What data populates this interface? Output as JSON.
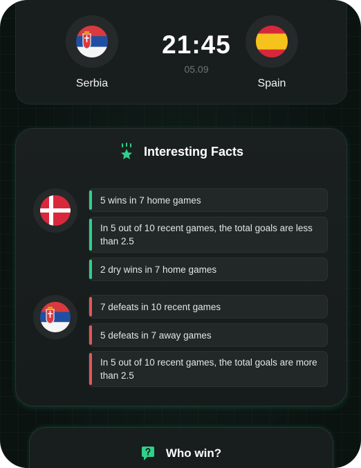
{
  "match": {
    "home_team": "Serbia",
    "away_team": "Spain",
    "time": "21:45",
    "date": "05.09"
  },
  "facts_section": {
    "title": "Interesting Facts",
    "home_facts": [
      "5 wins in 7 home games",
      "In 5 out of 10 recent games, the total goals are less than 2.5",
      "2 dry wins in 7 home games"
    ],
    "away_facts": [
      "7 defeats in 10 recent games",
      "5 defeats in 7 away games",
      "In 5 out of 10 recent games, the total goals are more than 2.5"
    ]
  },
  "poll_section": {
    "title": "Who win?"
  },
  "colors": {
    "accent": "#2fd08a",
    "positive": "#2fd08a",
    "negative": "#e2575c",
    "background": "#0c1513",
    "card": "#181d1d"
  },
  "icons": {
    "facts": "star-icon",
    "poll": "chat-question-icon"
  }
}
